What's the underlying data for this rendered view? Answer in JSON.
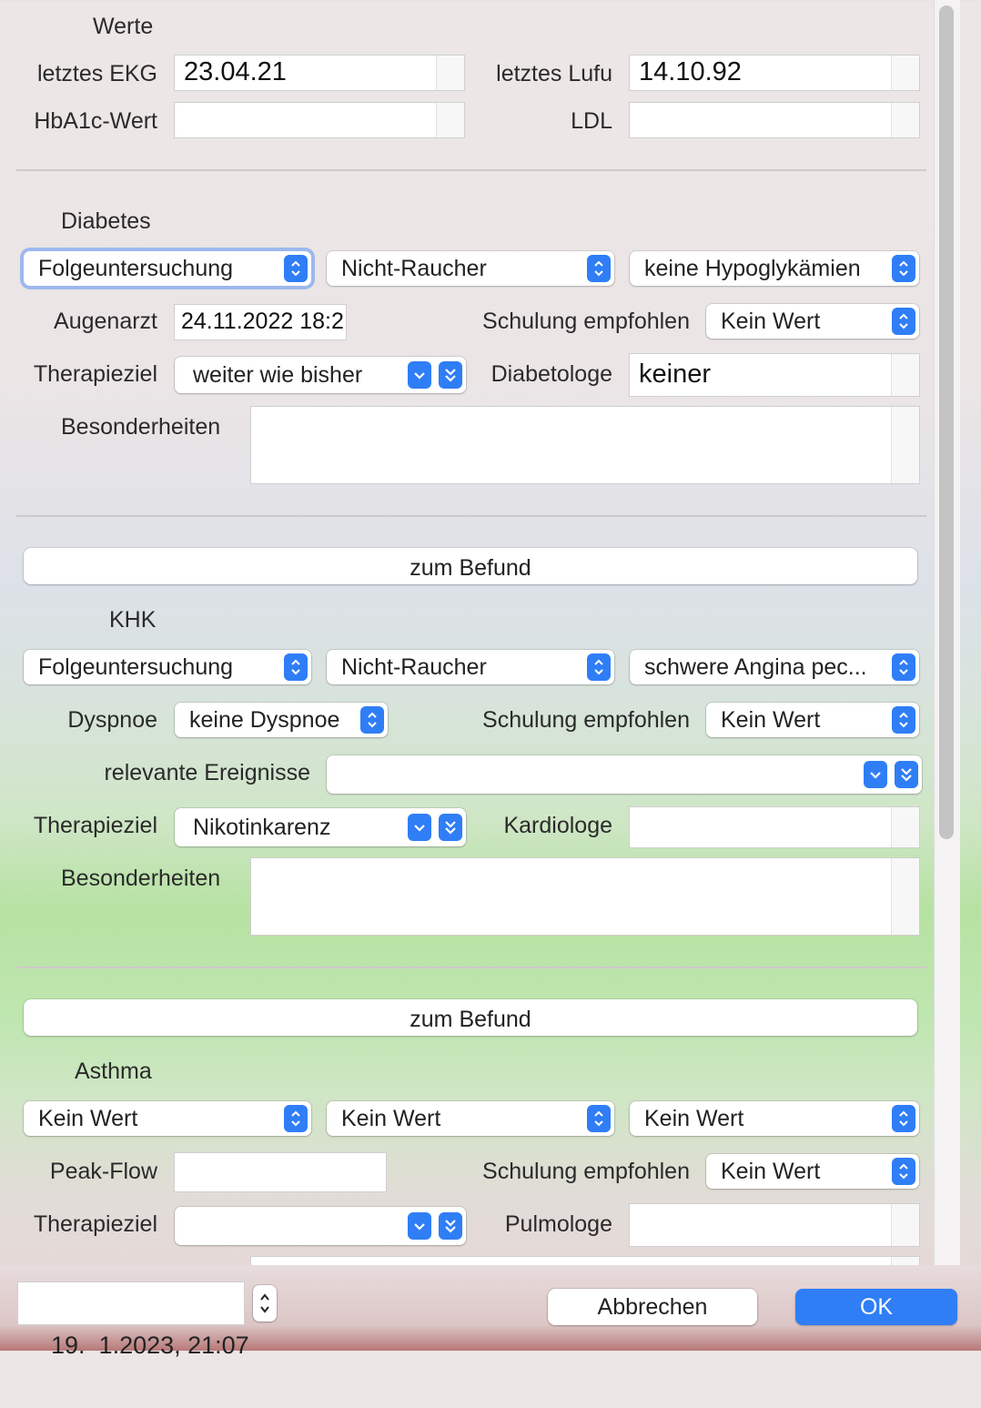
{
  "werte": {
    "title": "Werte",
    "ekg_label": "letztes EKG",
    "ekg_value": "23.04.21",
    "lufu_label": "letztes Lufu",
    "lufu_value": "14.10.92",
    "hba1c_label": "HbA1c-Wert",
    "hba1c_value": "",
    "ldl_label": "LDL",
    "ldl_value": ""
  },
  "diabetes": {
    "title": "Diabetes",
    "pop1": "Folgeuntersuchung",
    "pop2": "Nicht-Raucher",
    "pop3": "keine Hypoglykämien",
    "augenarzt_label": "Augenarzt",
    "augenarzt_value": "24.11.2022 18:2",
    "schulung_label": "Schulung empfohlen",
    "schulung_value": "Kein Wert",
    "therapie_label": "Therapieziel",
    "therapie_value": "weiter wie bisher",
    "diabetologe_label": "Diabetologe",
    "diabetologe_value": "keiner",
    "besonderheiten_label": "Besonderheiten"
  },
  "khk": {
    "befund_button": "zum Befund",
    "title": "KHK",
    "pop1": "Folgeuntersuchung",
    "pop2": "Nicht-Raucher",
    "pop3": "schwere Angina pec...",
    "dyspnoe_label": "Dyspnoe",
    "dyspnoe_value": "keine Dyspnoe",
    "schulung_label": "Schulung empfohlen",
    "schulung_value": "Kein Wert",
    "ereignisse_label": "relevante Ereignisse",
    "ereignisse_value": "",
    "therapie_label": "Therapieziel",
    "therapie_value": "Nikotinkarenz",
    "kardiologe_label": "Kardiologe",
    "kardiologe_value": "",
    "besonderheiten_label": "Besonderheiten"
  },
  "asthma": {
    "befund_button": "zum Befund",
    "title": "Asthma",
    "pop1": "Kein Wert",
    "pop2": "Kein Wert",
    "pop3": "Kein Wert",
    "peakflow_label": "Peak-Flow",
    "peakflow_value": "",
    "schulung_label": "Schulung empfohlen",
    "schulung_value": "Kein Wert",
    "therapie_label": "Therapieziel",
    "therapie_value": "",
    "pulmologe_label": "Pulmologe",
    "pulmologe_value": ""
  },
  "footer": {
    "datetime": "19.  1.2023, 21:07",
    "cancel": "Abbrechen",
    "ok": "OK"
  },
  "colors": {
    "accent": "#2f7ef6",
    "ok_button": "#2f7ef6"
  }
}
